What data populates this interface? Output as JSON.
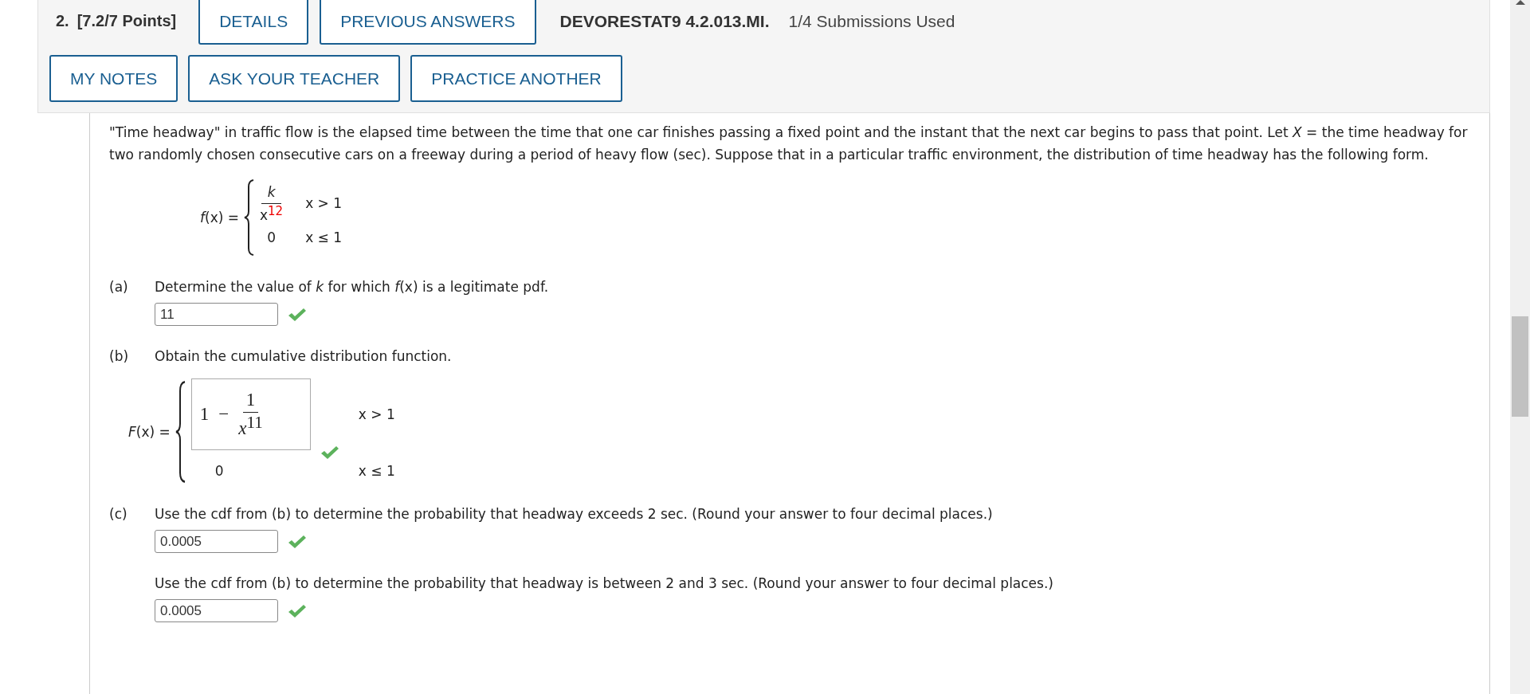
{
  "header": {
    "number": "2.",
    "points": "[7.2/7 Points]",
    "buttons_top": [
      "DETAILS",
      "PREVIOUS ANSWERS"
    ],
    "code": "DEVORESTAT9 4.2.013.MI.",
    "submissions": "1/4 Submissions Used",
    "buttons_bottom": [
      "MY NOTES",
      "ASK YOUR TEACHER",
      "PRACTICE ANOTHER"
    ]
  },
  "intro": "\"Time headway\" in traffic flow is the elapsed time between the time that one car finishes passing a fixed point and the instant that the next car begins to pass that point. Let *X* = the time headway for two randomly chosen consecutive cars on a freeway during a period of heavy flow (sec). Suppose that in a particular traffic environment, the distribution of time headway has the following form.",
  "pdf": {
    "lhs": "*f*(x) =",
    "cases": [
      {
        "kind": "fraction",
        "numerator": "k",
        "denominator": "x",
        "exponent": "12",
        "exponent_highlighted": true,
        "condition": "x > 1"
      },
      {
        "kind": "value",
        "value": "0",
        "condition": "x ≤ 1"
      }
    ]
  },
  "parts": [
    {
      "kind": "input",
      "label": "(a)",
      "prompt": "Determine the value of *k* for which *f*(x) is a legitimate pdf.",
      "answer": "11",
      "correct": true
    },
    {
      "kind": "cdf",
      "label": "(b)",
      "prompt": "Obtain the cumulative distribution function.",
      "lhs": "*F*(x) =",
      "cases": [
        {
          "kind": "math",
          "whole": "1",
          "operator": "−",
          "numerator": "1",
          "denominator": "x",
          "exponent": "11",
          "condition": "x > 1",
          "correct": true
        },
        {
          "kind": "value",
          "value": "0",
          "condition": "x ≤ 1"
        }
      ]
    },
    {
      "kind": "input",
      "label": "(c)",
      "prompt": "Use the cdf from (b) to determine the probability that headway exceeds 2 sec. (Round your answer to four decimal places.)",
      "answer": "0.0005",
      "correct": true
    },
    {
      "kind": "input",
      "prompt": "Use the cdf from (b) to determine the probability that headway is between 2 and 3 sec. (Round your answer to four decimal places.)",
      "answer": "0.0005",
      "correct": true
    }
  ]
}
